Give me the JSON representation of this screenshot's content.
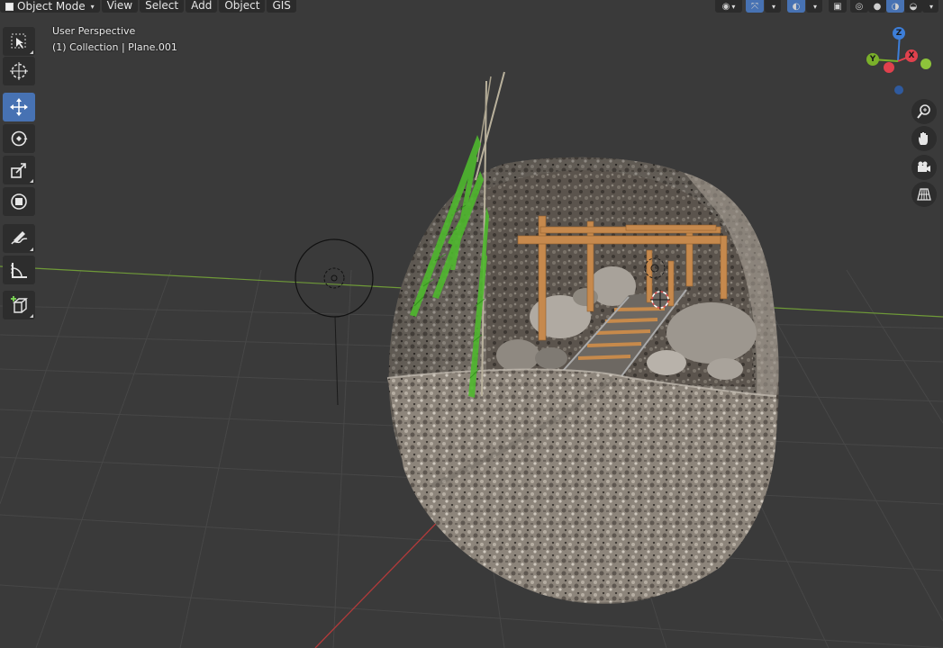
{
  "header": {
    "mode_label": "Object Mode",
    "menus": [
      "View",
      "Select",
      "Add",
      "Object",
      "GIS"
    ]
  },
  "viewport": {
    "perspective_label": "User Perspective",
    "collection_label": "(1) Collection | Plane.001"
  },
  "toolbar": {
    "tools": [
      {
        "name": "select-box-tool",
        "icon": "select-box-icon",
        "active": false
      },
      {
        "name": "cursor-tool",
        "icon": "cursor-icon",
        "active": false
      },
      {
        "name": "move-tool",
        "icon": "move-icon",
        "active": true
      },
      {
        "name": "rotate-tool",
        "icon": "rotate-icon",
        "active": false
      },
      {
        "name": "scale-tool",
        "icon": "scale-icon",
        "active": false
      },
      {
        "name": "transform-tool",
        "icon": "transform-icon",
        "active": false
      },
      {
        "name": "annotate-tool",
        "icon": "annotate-icon",
        "active": false
      },
      {
        "name": "measure-tool",
        "icon": "measure-icon",
        "active": false
      },
      {
        "name": "add-cube-tool",
        "icon": "add-cube-icon",
        "active": false
      }
    ]
  },
  "gizmo": {
    "axes": {
      "x": "X",
      "y": "Y",
      "z": "Z"
    },
    "colors": {
      "x": "#e0414d",
      "y": "#7ab02a",
      "z": "#3d7ed8",
      "x_neg": "#b04652",
      "y_neg": "#8dc43a",
      "z_neg": "#2f5a9e"
    }
  },
  "nav_buttons": [
    "zoom-icon",
    "hand-pan-icon",
    "camera-icon",
    "grid-ortho-icon"
  ],
  "colors": {
    "background": "#3a3a3a",
    "grid": "#4a4a4a",
    "accent": "#4772b3",
    "x_axis_line": "#b43a3a",
    "y_axis_line": "#6f9a38"
  }
}
